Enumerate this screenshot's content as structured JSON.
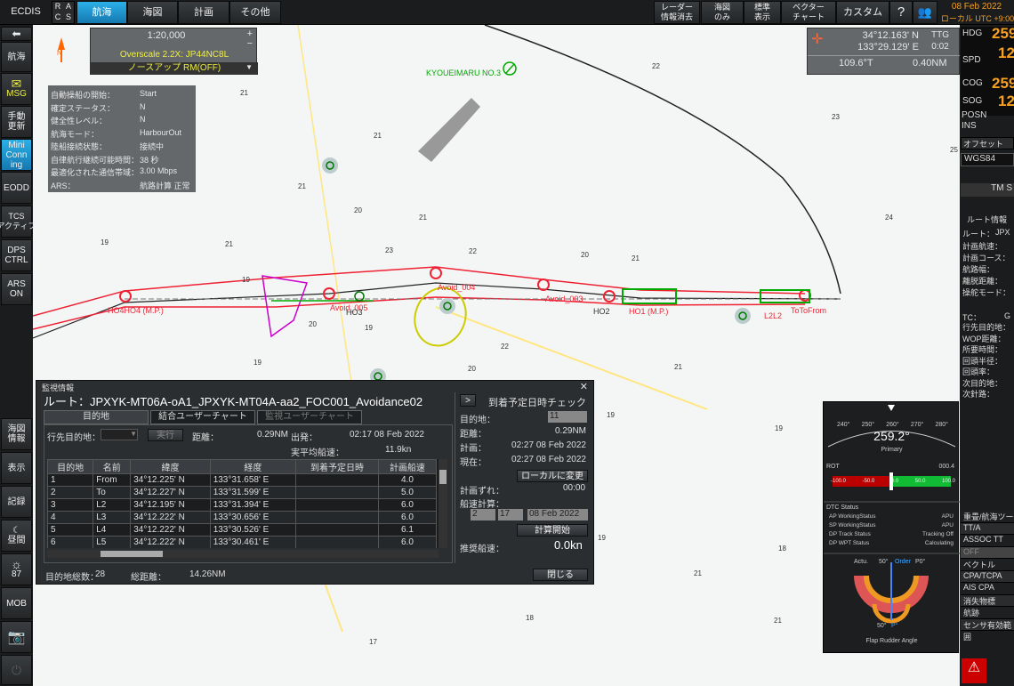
{
  "topbar": {
    "app": "ECDIS",
    "rac": [
      "R",
      "A",
      "C",
      "S"
    ],
    "tabs": [
      "航海",
      "海図",
      "計画",
      "その他"
    ],
    "right": [
      "レーダー\n情報消去",
      "海図\nのみ",
      "標準\n表示",
      "ベクター\nチャート",
      "カスタム"
    ],
    "date": "08 Feb 2022",
    "tz": "ローカル UTC +9:00"
  },
  "leftbar": [
    "航海",
    "MSG",
    "手動\n更新",
    "Mini\nConn\ning",
    "EODD",
    "TCS\nアクティブ",
    "DPS\nCTRL",
    "ARS\nON",
    "海図\n情報",
    "表示",
    "記録",
    "昼間",
    "87",
    "MOB"
  ],
  "scale": {
    "value": "1:20,000",
    "overscale": "Overscale 2.2X: JP44NC8L",
    "mode": "ノースアップ RM(OFF)"
  },
  "position": {
    "lat": "34°12.163' N",
    "lon": "133°29.129' E",
    "ttg_label": "TTG",
    "ttg": "0:02",
    "bearing": "109.6°T",
    "dist": "0.40NM"
  },
  "status": [
    [
      "自動操船の開始：",
      "Start"
    ],
    [
      "確定ステータス：",
      "N"
    ],
    [
      "健全性レベル：",
      "N"
    ],
    [
      "航海モード：",
      "HarbourOut"
    ],
    [
      "陸船接続状態：",
      "接続中"
    ],
    [
      "自律航行継続可能時間：",
      "38 秒"
    ],
    [
      "最適化された通信帯域：",
      "3.00 Mbps"
    ],
    [
      "ARS：",
      "航路計算 正常"
    ]
  ],
  "rightbar": {
    "hdg_l": "HDG",
    "hdg": "259",
    "spd_l": "SPD",
    "spd": "12",
    "cog_l": "COG",
    "cog": "259",
    "sog_l": "SOG",
    "sog": "12",
    "posn": "POSN",
    "ins": "INS",
    "offset": "オフセット",
    "wgs": "WGS84",
    "tm": "TM S",
    "route_info": "ルート情報",
    "route": "ルート：",
    "route_v": "JPX",
    "labels": [
      "計画航速：",
      "計画コース：",
      "航路幅：",
      "離脱距離：",
      "操舵モード："
    ],
    "labels2": [
      "TC：",
      "行先目的地：",
      "WOP距離：",
      "所要時間：",
      "回頭半径：",
      "回頭率：",
      "次目的地：",
      "次針路："
    ],
    "tc_v": "G",
    "bottom": [
      "重畳/航海ツー",
      "TT/A",
      "ASSOC TT",
      "OFF",
      "ベクトル",
      "CPA/TCPA",
      "AIS CPA",
      "消失物標",
      "航跡",
      "センサ有効範囲"
    ]
  },
  "map": {
    "ship_label": "KYOUEIMARU NO.3",
    "wp_labels": [
      "HO4HO4 (M.P.)",
      "Avoid_005",
      "HO3",
      "Avoid_004",
      "Avoid_003",
      "HO2",
      "HO1 (M.P.)",
      "L2L2",
      "ToToFrom"
    ],
    "depths": [
      "22",
      "23",
      "25",
      "21",
      "21",
      "21",
      "20",
      "21",
      "19",
      "21",
      "23",
      "22",
      "20",
      "21",
      "19",
      "20",
      "19",
      "22",
      "19",
      "20",
      "21",
      "21",
      "19",
      "19",
      "24",
      "18",
      "18",
      "17",
      "21",
      "19",
      "19",
      "20",
      "19",
      "21",
      "22"
    ]
  },
  "dialog": {
    "header": "監視情報",
    "route": "ルート：JPXYK-MT06A-oA1_JPXYK-MT04A-aa2_FOC001_Avoidance02",
    "tabs": [
      "目的地",
      "結合ユーザーチャート",
      "監視ユーザーチャート"
    ],
    "dest_label": "行先目的地：",
    "exec": "実行",
    "dist_label": "距離：",
    "dist": "0.29NM",
    "dep_label": "出発：",
    "dep": "02:17 08 Feb 2022",
    "act_label": "実平均船速：",
    "act": "11.9kn",
    "cols": [
      "目的地",
      "名前",
      "緯度",
      "経度",
      "到着予定日時",
      "計画船速"
    ],
    "rows": [
      [
        "1",
        "From",
        "34°12.225' N",
        "133°31.658' E",
        "",
        "4.0"
      ],
      [
        "2",
        "To",
        "34°12.227' N",
        "133°31.599' E",
        "",
        "5.0"
      ],
      [
        "3",
        "L2",
        "34°12.195' N",
        "133°31.394' E",
        "",
        "6.0"
      ],
      [
        "4",
        "L3",
        "34°12.222' N",
        "133°30.656' E",
        "",
        "6.0"
      ],
      [
        "5",
        "L4",
        "34°12.222' N",
        "133°30.526' E",
        "",
        "6.1"
      ],
      [
        "6",
        "L5",
        "34°12.222' N",
        "133°30.461' E",
        "",
        "6.0"
      ]
    ],
    "total_wp_label": "目的地総数：",
    "total_wp": "28",
    "total_dist_label": "総距離：",
    "total_dist": "14.26NM",
    "eta_title": "到着予定日時チェック",
    "eta_btn": ">",
    "eta": [
      [
        "目的地：",
        "11"
      ],
      [
        "距離：",
        "0.29NM"
      ],
      [
        "計画：",
        "02:27 08 Feb 2022"
      ],
      [
        "現在：",
        "02:27 08 Feb 2022"
      ]
    ],
    "local_btn": "ローカルに変更",
    "diff_label": "計画ずれ：",
    "diff": "00:00",
    "calc_label": "船速計算：",
    "calc_h": "2",
    "calc_m": "17",
    "calc_d": "08 Feb 2022",
    "calc_btn": "計算開始",
    "rec_label": "推奨船速：",
    "rec": "0.0kn",
    "close": "閉じる"
  },
  "gauge": {
    "hdg": "259.2°",
    "primary": "Primary",
    "ticks": [
      "240°",
      "250°",
      "260°",
      "270°",
      "280°"
    ],
    "rot": "ROT",
    "rot_v": "000.4",
    "rot_ticks": [
      "-100.0",
      "-50.0",
      "0.0",
      "50.0",
      "100.0"
    ],
    "dtc": "DTC Status",
    "dtc_rows": [
      [
        "AP WorkingStatus",
        "APU"
      ],
      [
        "SP WorkingStatus",
        "APU"
      ],
      [
        "DP Track Status",
        "Tracking Off"
      ],
      [
        "DP WPT Status",
        "Calculating"
      ]
    ],
    "actu": "Actu.",
    "order": "Order",
    "a50": "50°",
    "o0": "P0°",
    "a50b": "50°",
    "pp": "P°",
    "flap": "Flap Rudder Angle"
  }
}
